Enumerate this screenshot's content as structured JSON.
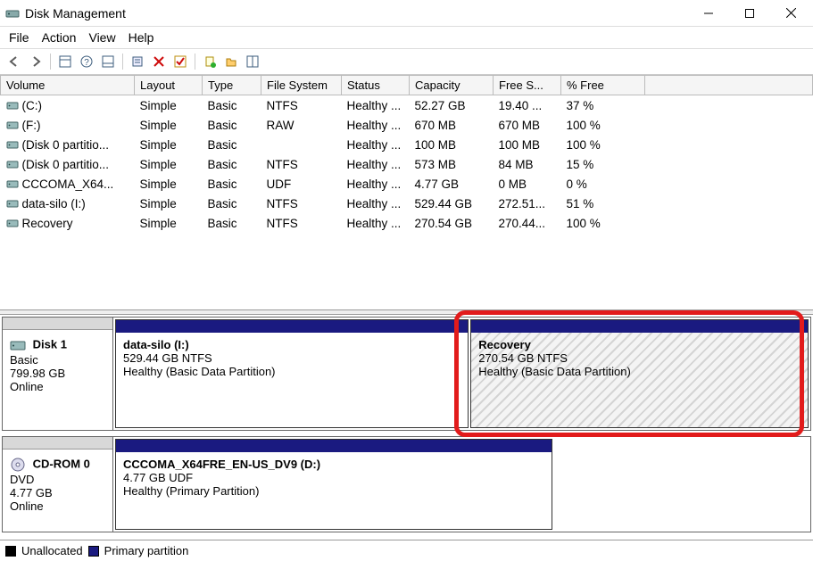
{
  "window": {
    "title": "Disk Management"
  },
  "menu": {
    "file": "File",
    "action": "Action",
    "view": "View",
    "help": "Help"
  },
  "columns": {
    "volume": "Volume",
    "layout": "Layout",
    "type": "Type",
    "fs": "File System",
    "status": "Status",
    "capacity": "Capacity",
    "free": "Free S...",
    "pctfree": "% Free"
  },
  "volumes": [
    {
      "name": "(C:)",
      "layout": "Simple",
      "type": "Basic",
      "fs": "NTFS",
      "status": "Healthy ...",
      "capacity": "52.27 GB",
      "free": "19.40 ...",
      "pctfree": "37 %"
    },
    {
      "name": "(F:)",
      "layout": "Simple",
      "type": "Basic",
      "fs": "RAW",
      "status": "Healthy ...",
      "capacity": "670 MB",
      "free": "670 MB",
      "pctfree": "100 %"
    },
    {
      "name": "(Disk 0 partitio...",
      "layout": "Simple",
      "type": "Basic",
      "fs": "",
      "status": "Healthy ...",
      "capacity": "100 MB",
      "free": "100 MB",
      "pctfree": "100 %"
    },
    {
      "name": "(Disk 0 partitio...",
      "layout": "Simple",
      "type": "Basic",
      "fs": "NTFS",
      "status": "Healthy ...",
      "capacity": "573 MB",
      "free": "84 MB",
      "pctfree": "15 %"
    },
    {
      "name": "CCCOMA_X64...",
      "layout": "Simple",
      "type": "Basic",
      "fs": "UDF",
      "status": "Healthy ...",
      "capacity": "4.77 GB",
      "free": "0 MB",
      "pctfree": "0 %"
    },
    {
      "name": "data-silo (I:)",
      "layout": "Simple",
      "type": "Basic",
      "fs": "NTFS",
      "status": "Healthy ...",
      "capacity": "529.44 GB",
      "free": "272.51...",
      "pctfree": "51 %"
    },
    {
      "name": "Recovery",
      "layout": "Simple",
      "type": "Basic",
      "fs": "NTFS",
      "status": "Healthy ...",
      "capacity": "270.54 GB",
      "free": "270.44...",
      "pctfree": "100 %"
    }
  ],
  "disks": {
    "disk1": {
      "name": "Disk 1",
      "type": "Basic",
      "size": "799.98 GB",
      "status": "Online",
      "parts": [
        {
          "name": "data-silo  (I:)",
          "line2": "529.44 GB NTFS",
          "line3": "Healthy (Basic Data Partition)",
          "hatched": false,
          "widthPct": 51
        },
        {
          "name": "Recovery",
          "line2": "270.54 GB NTFS",
          "line3": "Healthy (Basic Data Partition)",
          "hatched": true,
          "widthPct": 49
        }
      ]
    },
    "cdrom0": {
      "name": "CD-ROM 0",
      "type": "DVD",
      "size": "4.77 GB",
      "status": "Online",
      "parts": [
        {
          "name": "CCCOMA_X64FRE_EN-US_DV9  (D:)",
          "line2": "4.77 GB UDF",
          "line3": "Healthy (Primary Partition)",
          "hatched": false,
          "widthPct": 63
        }
      ]
    }
  },
  "legend": {
    "unallocated": "Unallocated",
    "primary": "Primary partition"
  }
}
